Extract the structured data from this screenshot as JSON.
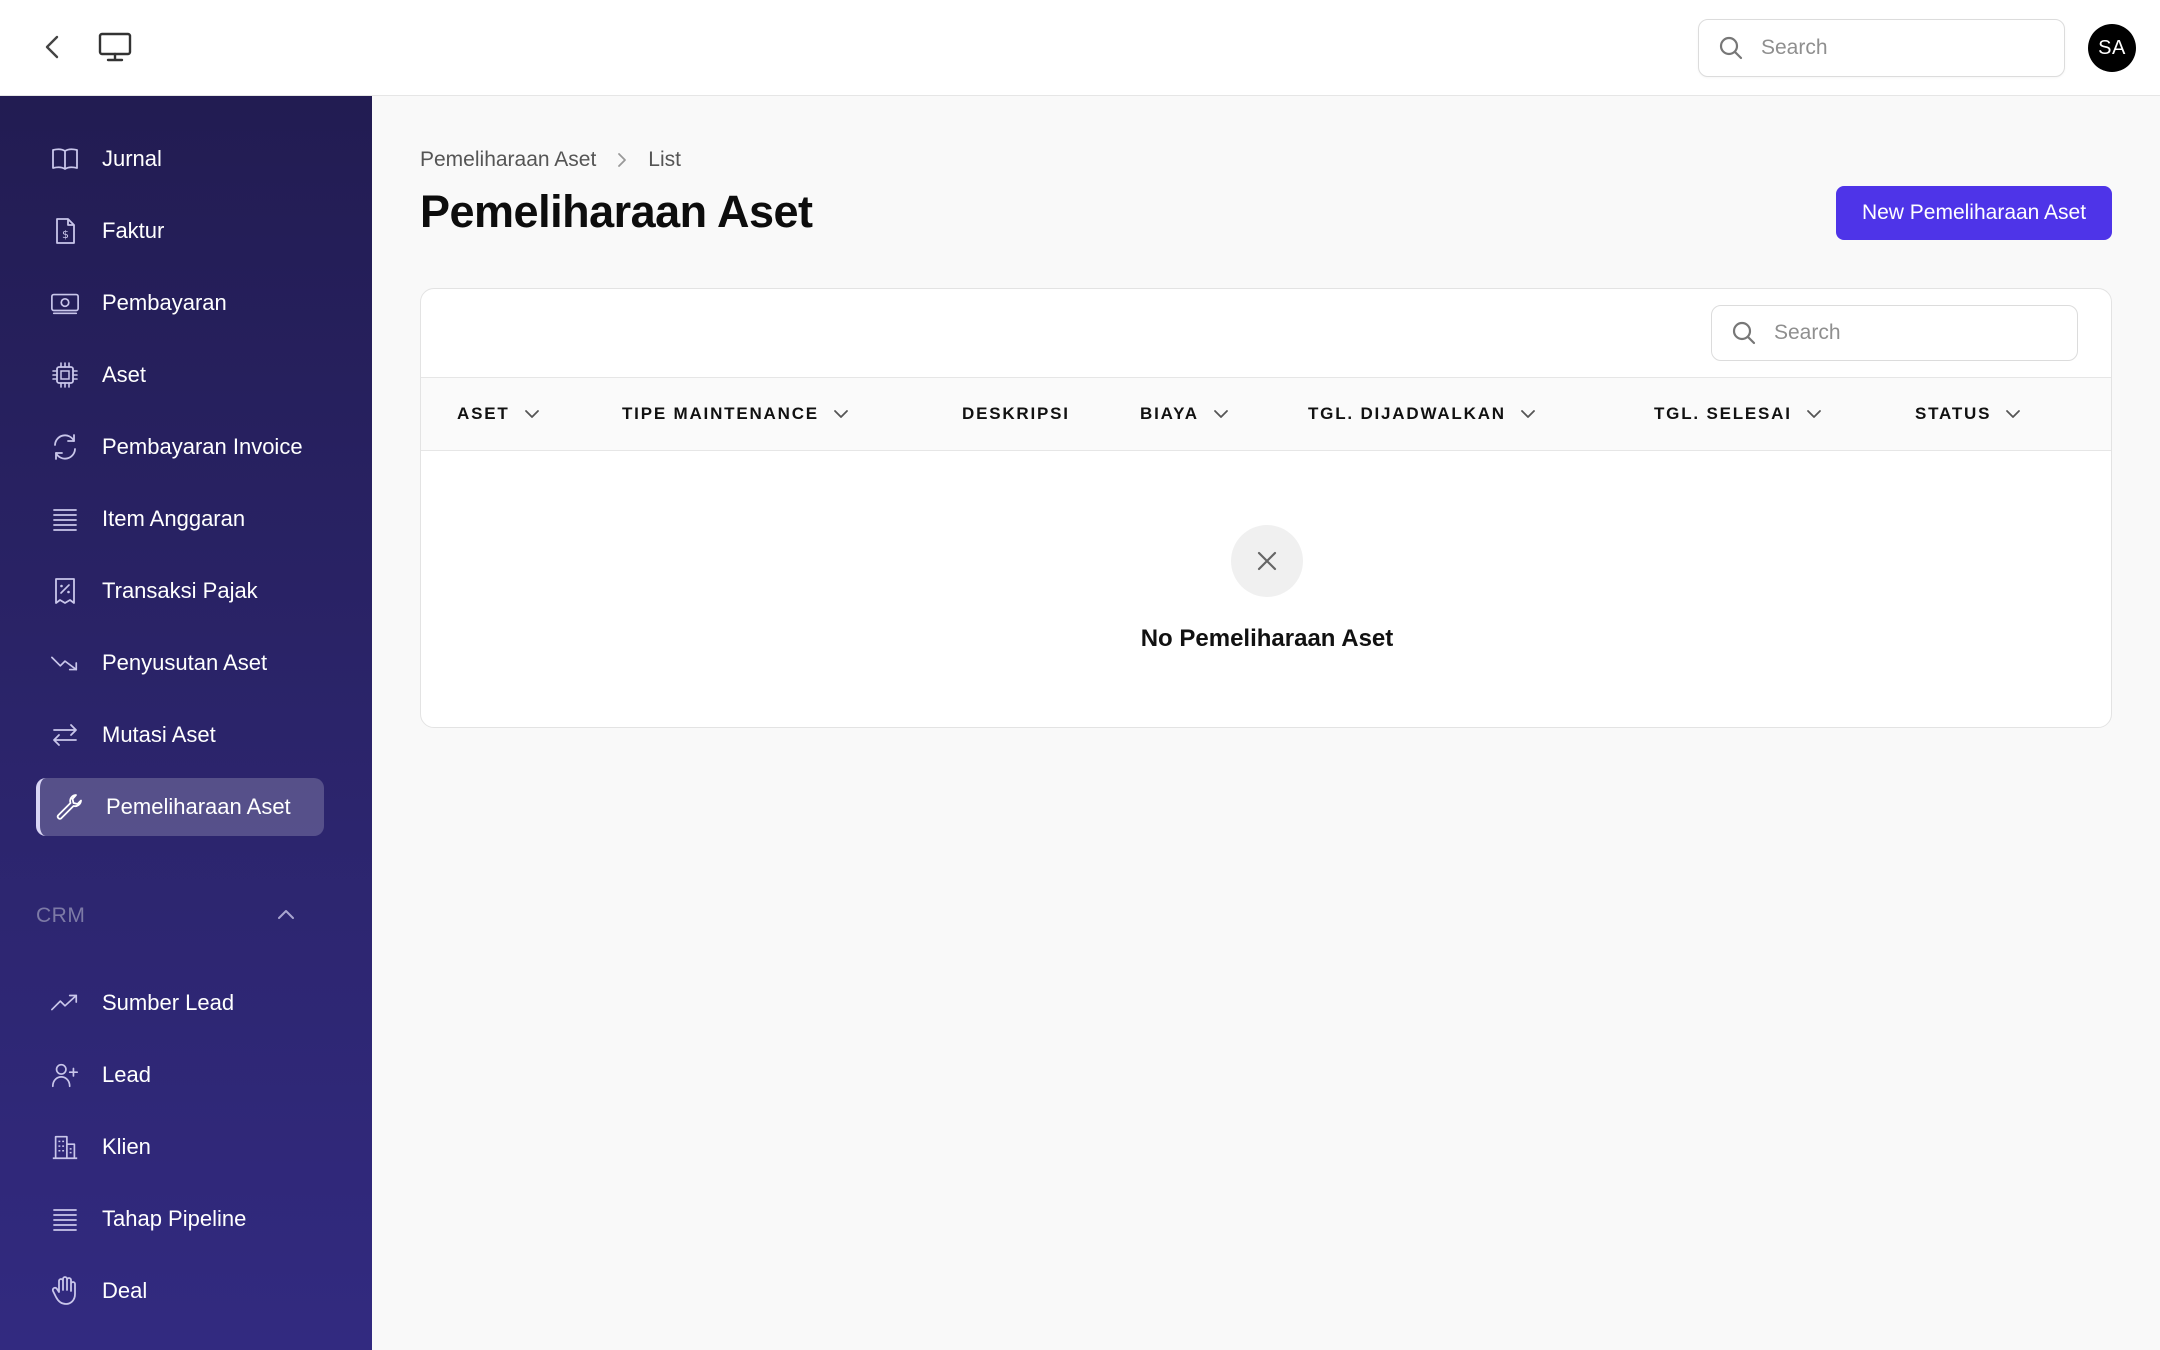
{
  "topbar": {
    "search_placeholder": "Search",
    "avatar_initials": "SA"
  },
  "sidebar": {
    "items": [
      {
        "label": "Jurnal",
        "icon": "book-open-icon"
      },
      {
        "label": "Faktur",
        "icon": "document-dollar-icon"
      },
      {
        "label": "Pembayaran",
        "icon": "banknote-icon"
      },
      {
        "label": "Aset",
        "icon": "cpu-chip-icon"
      },
      {
        "label": "Pembayaran Invoice",
        "icon": "refresh-icon"
      },
      {
        "label": "Item Anggaran",
        "icon": "stacked-lines-icon"
      },
      {
        "label": "Transaksi Pajak",
        "icon": "receipt-percent-icon"
      },
      {
        "label": "Penyusutan Aset",
        "icon": "trending-down-icon"
      },
      {
        "label": "Mutasi Aset",
        "icon": "arrows-right-left-icon"
      },
      {
        "label": "Pemeliharaan Aset",
        "icon": "wrench-icon",
        "active": true
      }
    ],
    "crm_section": {
      "label": "CRM",
      "items": [
        {
          "label": "Sumber Lead",
          "icon": "trending-up-icon"
        },
        {
          "label": "Lead",
          "icon": "user-plus-icon"
        },
        {
          "label": "Klien",
          "icon": "building-office-icon"
        },
        {
          "label": "Tahap Pipeline",
          "icon": "stacked-lines-icon"
        },
        {
          "label": "Deal",
          "icon": "hand-raised-icon"
        }
      ]
    }
  },
  "breadcrumb": {
    "parent": "Pemeliharaan Aset",
    "current": "List"
  },
  "page": {
    "title": "Pemeliharaan Aset",
    "new_button_label": "New Pemeliharaan Aset"
  },
  "table": {
    "search_placeholder": "Search",
    "columns": [
      {
        "label": "ASET",
        "sortable": true
      },
      {
        "label": "TIPE MAINTENANCE",
        "sortable": true
      },
      {
        "label": "DESKRIPSI",
        "sortable": false
      },
      {
        "label": "BIAYA",
        "sortable": true
      },
      {
        "label": "TGL. DIJADWALKAN",
        "sortable": true
      },
      {
        "label": "TGL. SELESAI",
        "sortable": true
      },
      {
        "label": "STATUS",
        "sortable": true
      }
    ],
    "rows": [],
    "empty_text": "No Pemeliharaan Aset"
  },
  "colors": {
    "accent": "#4e34e8",
    "sidebar_top": "#221c52",
    "sidebar_bottom": "#322a80"
  }
}
